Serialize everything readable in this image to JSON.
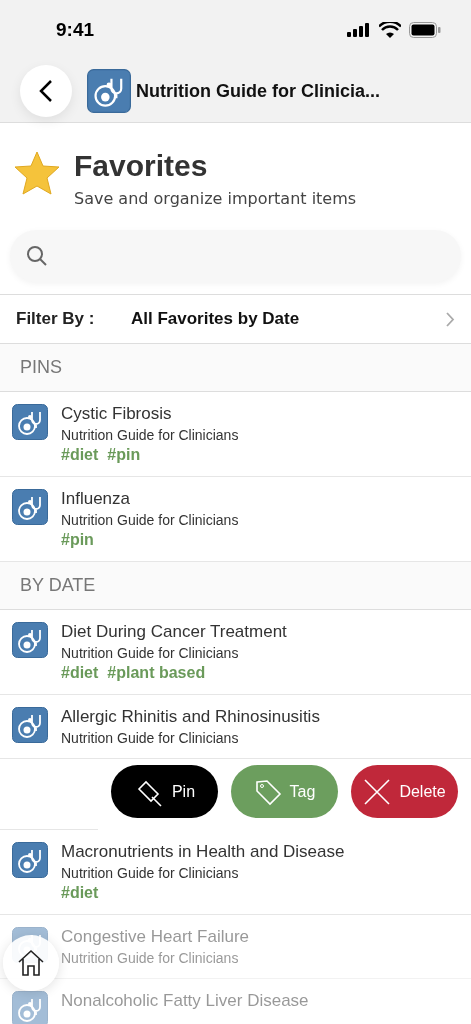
{
  "status_bar": {
    "time": "9:41"
  },
  "nav": {
    "title": "Nutrition Guide for Clinicia..."
  },
  "header": {
    "title": "Favorites",
    "subtitle": "Save and organize important items"
  },
  "filter": {
    "label": "Filter By :",
    "value": "All Favorites by Date"
  },
  "sections": [
    {
      "title": "PINS",
      "items": [
        {
          "kind": "item",
          "title": "Cystic Fibrosis",
          "source": "Nutrition Guide for Clinicians",
          "tags": [
            "#diet",
            "#pin"
          ],
          "faded": false
        },
        {
          "kind": "item",
          "title": "Influenza",
          "source": "Nutrition Guide for Clinicians",
          "tags": [
            "#pin"
          ],
          "faded": false
        }
      ]
    },
    {
      "title": "BY DATE",
      "items": [
        {
          "kind": "item",
          "title": "Diet During Cancer Treatment",
          "source": "Nutrition Guide for Clinicians",
          "tags": [
            "#diet",
            "#plant based"
          ],
          "faded": false
        },
        {
          "kind": "item",
          "title": "Allergic Rhinitis and Rhinosinusitis",
          "source": "Nutrition Guide for Clinicians",
          "faded": false
        },
        {
          "kind": "swiped",
          "actions": [
            {
              "kind": "pin",
              "label": "Pin"
            },
            {
              "kind": "tag",
              "label": "Tag"
            },
            {
              "kind": "delete",
              "label": "Delete"
            }
          ]
        },
        {
          "kind": "item",
          "title": "Macronutrients in Health and Disease",
          "source": "Nutrition Guide for Clinicians",
          "tags": [
            "#diet"
          ],
          "faded": false
        },
        {
          "kind": "item",
          "title": "Congestive Heart Failure",
          "source": "Nutrition Guide for Clinicians",
          "faded": true
        },
        {
          "kind": "item",
          "title": "Nonalcoholic Fatty Liver Disease",
          "faded": true
        }
      ]
    }
  ]
}
